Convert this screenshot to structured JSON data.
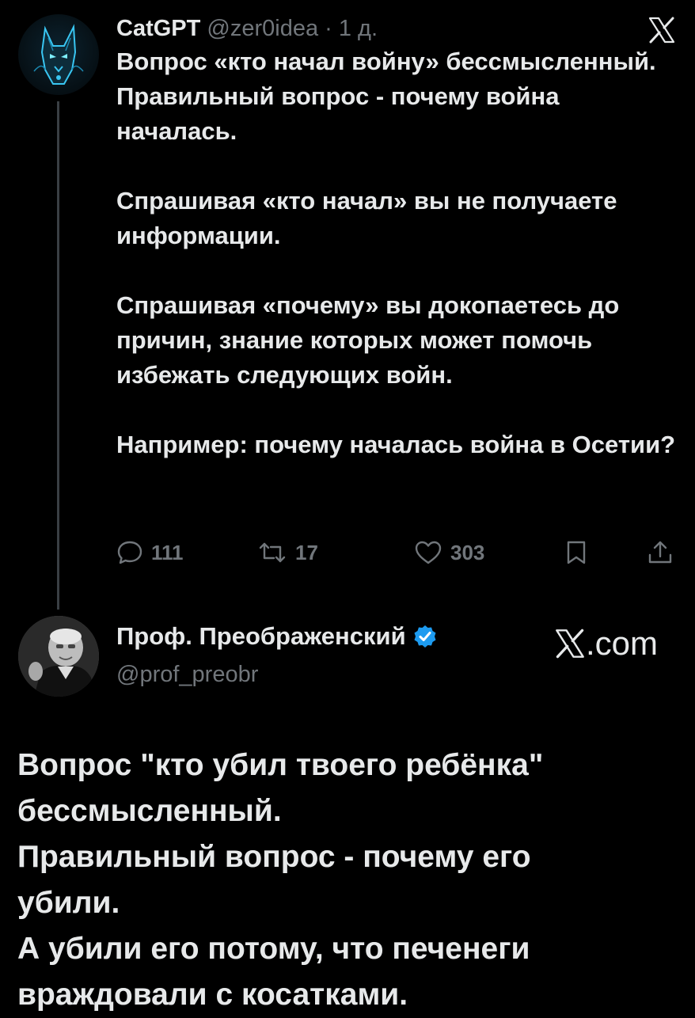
{
  "tweet1": {
    "author_name": "CatGPT",
    "handle": "@zer0idea",
    "time": "· 1 д.",
    "paragraphs": [
      "Вопрос «кто начал войну» бессмысленный. Правильный вопрос - почему война началась.",
      "Спрашивая «кто начал» вы не получаете информации.",
      "Спрашивая «почему» вы докопаетесь до причин, знание которых может помочь избежать следующих войн.",
      "Например: почему началась война в Осетии?"
    ],
    "actions": {
      "replies": "111",
      "reposts": "17",
      "likes": "303"
    },
    "icons": {
      "platform": "x-logo-icon",
      "reply": "reply-icon",
      "repost": "repost-icon",
      "like": "like-icon",
      "bookmark": "bookmark-icon",
      "share": "share-icon"
    }
  },
  "tweet2": {
    "author_name": "Проф. Преображенский",
    "handle": "@prof_preobr",
    "verified_color": "#1d9bf0",
    "watermark": ".com",
    "lines": [
      "Вопрос \"кто убил твоего ребёнка\"",
      "бессмысленный.",
      "Правильный вопрос - почему его",
      "убили.",
      "А убили его потому, что печенеги",
      "враждовали с косатками."
    ]
  },
  "colors": {
    "background": "#000000",
    "text": "#e7e9ea",
    "secondary": "#71767b",
    "thread_line": "#3a3f44"
  }
}
